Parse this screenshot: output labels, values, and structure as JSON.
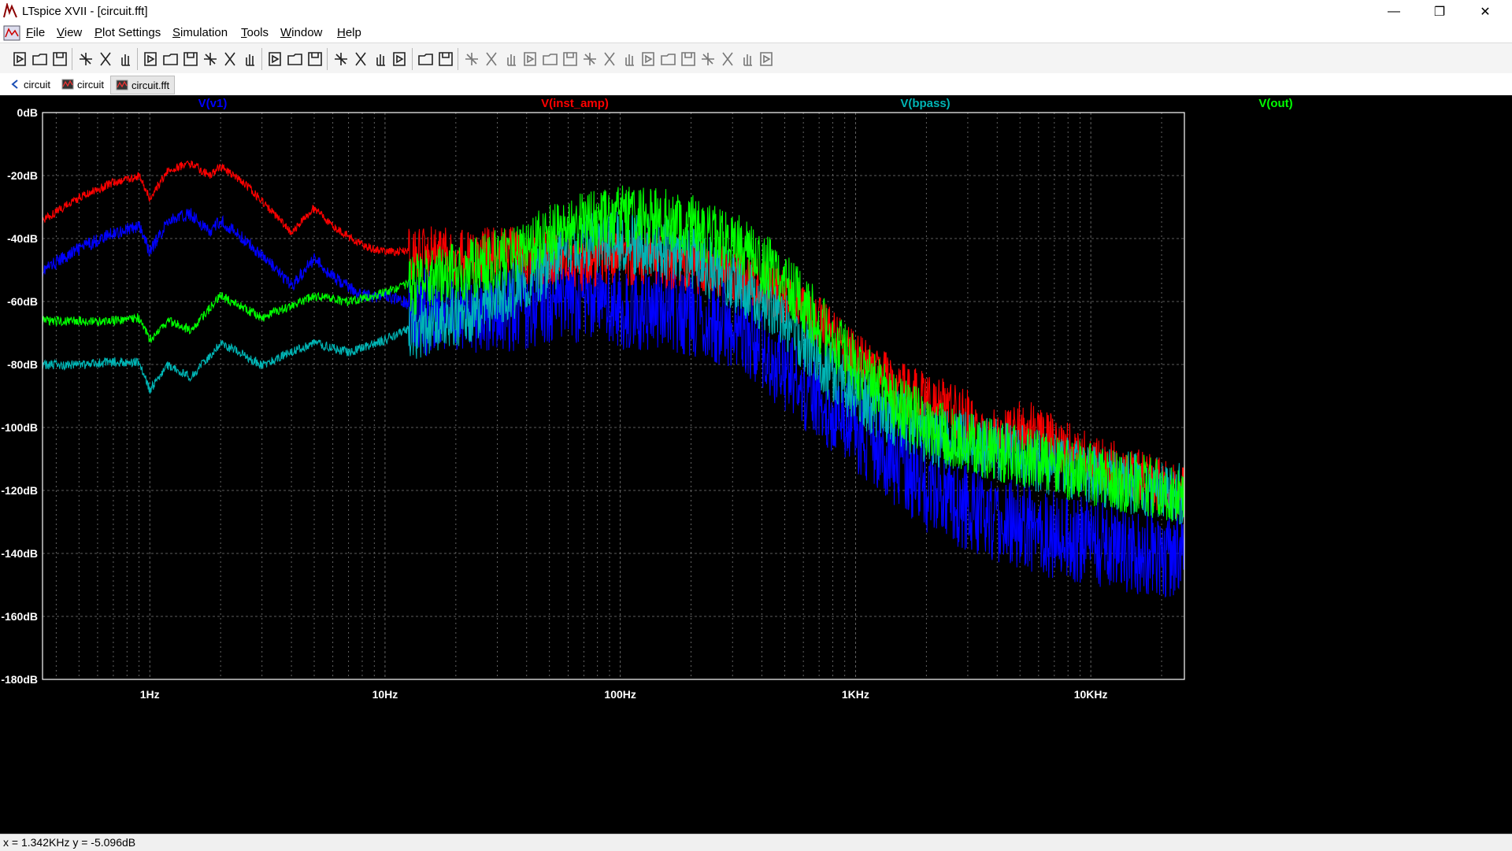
{
  "window": {
    "title": "LTspice XVII - [circuit.fft]",
    "min_glyph": "—",
    "restore_glyph": "❐",
    "close_glyph": "✕"
  },
  "menu": [
    {
      "label": "File",
      "u": "F",
      "rest": "ile"
    },
    {
      "label": "View",
      "u": "V",
      "rest": "iew"
    },
    {
      "label": "Plot Settings",
      "u": "P",
      "rest": "lot Settings"
    },
    {
      "label": "Simulation",
      "u": "S",
      "rest": "imulation"
    },
    {
      "label": "Tools",
      "u": "T",
      "rest": "ools"
    },
    {
      "label": "Window",
      "u": "W",
      "rest": "indow"
    },
    {
      "label": "Help",
      "u": "H",
      "rest": "elp"
    }
  ],
  "mdi": {
    "min": "–",
    "restore": "▫",
    "close": "×"
  },
  "tabs": [
    {
      "label": "circuit",
      "icon": "schematic-icon"
    },
    {
      "label": "circuit",
      "icon": "waveform-icon"
    },
    {
      "label": "circuit.fft",
      "icon": "waveform-icon"
    }
  ],
  "toolbar_icons": [
    "run-icon",
    "open-icon",
    "save-icon",
    "control-panel-icon",
    "halt-icon",
    "pan-icon",
    "zoom-in-icon",
    "zoom-fit-icon",
    "zoom-out-icon",
    "zoom-cancel-icon",
    "autorange-icon",
    "zoom-area-icon",
    "tile-horizontal-icon",
    "cascade-icon",
    "tile-vertical-icon",
    "cut-icon",
    "copy-icon",
    "paste-icon",
    "find-icon",
    "print-icon",
    "print-preview-icon",
    "wire-icon",
    "ground-icon",
    "label-icon",
    "resistor-icon",
    "capacitor-icon",
    "inductor-icon",
    "diode-icon",
    "component-icon",
    "move-icon",
    "drag-icon",
    "undo-icon",
    "redo-icon",
    "rotate-icon",
    "mirror-icon",
    "text-icon",
    "spice-directive-icon"
  ],
  "chart_data": {
    "type": "line",
    "x_scale": "log",
    "x_unit": "Hz",
    "xlim": [
      0.35,
      25000
    ],
    "ylim": [
      -180,
      0
    ],
    "grid": true,
    "legend_placement": "top",
    "x_ticks": [
      {
        "v": 1,
        "label": "1Hz"
      },
      {
        "v": 10,
        "label": "10Hz"
      },
      {
        "v": 100,
        "label": "100Hz"
      },
      {
        "v": 1000,
        "label": "1KHz"
      },
      {
        "v": 10000,
        "label": "10KHz"
      }
    ],
    "y_ticks": [
      {
        "v": 0,
        "label": "0dB"
      },
      {
        "v": -20,
        "label": "-20dB"
      },
      {
        "v": -40,
        "label": "-40dB"
      },
      {
        "v": -60,
        "label": "-60dB"
      },
      {
        "v": -80,
        "label": "-80dB"
      },
      {
        "v": -100,
        "label": "-100dB"
      },
      {
        "v": -120,
        "label": "-120dB"
      },
      {
        "v": -140,
        "label": "-140dB"
      },
      {
        "v": -160,
        "label": "-160dB"
      },
      {
        "v": -180,
        "label": "-180dB"
      }
    ],
    "series": [
      {
        "name": "V(v1)",
        "color": "#0000ff",
        "ripple": 14,
        "x": [
          0.35,
          0.5,
          0.7,
          0.9,
          1,
          1.2,
          1.5,
          1.8,
          2,
          2.5,
          3,
          4,
          5,
          6,
          8,
          10,
          15,
          20,
          30,
          50,
          70,
          100,
          150,
          200,
          300,
          500,
          700,
          1000,
          1500,
          2000,
          3000,
          5000,
          7000,
          10000,
          15000,
          25000
        ],
        "y": [
          -50,
          -43,
          -38,
          -36,
          -44,
          -34,
          -32,
          -38,
          -34,
          -40,
          -45,
          -55,
          -46,
          -52,
          -58,
          -58,
          -62,
          -60,
          -62,
          -58,
          -58,
          -60,
          -60,
          -62,
          -66,
          -80,
          -90,
          -100,
          -110,
          -118,
          -124,
          -130,
          -133,
          -135,
          -138,
          -140
        ]
      },
      {
        "name": "V(inst_amp)",
        "color": "#ff0000",
        "ripple": 9,
        "x": [
          0.35,
          0.5,
          0.7,
          0.9,
          1,
          1.2,
          1.5,
          1.8,
          2,
          2.5,
          3,
          4,
          5,
          6,
          8,
          10,
          15,
          20,
          30,
          50,
          70,
          100,
          150,
          200,
          300,
          500,
          700,
          1000,
          1500,
          2000,
          3000,
          3500,
          5000,
          7000,
          10000,
          15000,
          25000
        ],
        "y": [
          -34,
          -27,
          -22,
          -20,
          -27,
          -18,
          -16,
          -20,
          -17,
          -22,
          -28,
          -38,
          -30,
          -36,
          -42,
          -44,
          -44,
          -45,
          -44,
          -45,
          -47,
          -45,
          -46,
          -48,
          -50,
          -58,
          -66,
          -78,
          -86,
          -90,
          -96,
          -104,
          -98,
          -104,
          -110,
          -114,
          -120
        ]
      },
      {
        "name": "V(bpass)",
        "color": "#00b4b4",
        "ripple": 10,
        "x": [
          0.35,
          0.5,
          0.7,
          0.9,
          1,
          1.2,
          1.5,
          2,
          3,
          5,
          7,
          10,
          15,
          20,
          30,
          50,
          70,
          100,
          150,
          200,
          300,
          500,
          700,
          1000,
          1500,
          2000,
          3000,
          5000,
          10000,
          25000
        ],
        "y": [
          -80,
          -80,
          -79,
          -79,
          -88,
          -80,
          -84,
          -73,
          -80,
          -73,
          -76,
          -72,
          -66,
          -64,
          -58,
          -48,
          -40,
          -40,
          -42,
          -45,
          -52,
          -64,
          -78,
          -88,
          -97,
          -101,
          -104,
          -108,
          -114,
          -120
        ]
      },
      {
        "name": "V(out)",
        "color": "#00ff00",
        "ripple": 10,
        "x": [
          0.35,
          0.5,
          0.7,
          0.9,
          1,
          1.2,
          1.5,
          2,
          3,
          5,
          7,
          10,
          15,
          20,
          30,
          50,
          70,
          100,
          150,
          200,
          300,
          500,
          700,
          1000,
          1500,
          2000,
          3000,
          5000,
          10000,
          25000
        ],
        "y": [
          -66,
          -66,
          -66,
          -65,
          -72,
          -66,
          -69,
          -58,
          -65,
          -58,
          -60,
          -57,
          -52,
          -50,
          -46,
          -38,
          -34,
          -32,
          -33,
          -35,
          -40,
          -52,
          -66,
          -80,
          -92,
          -98,
          -104,
          -108,
          -114,
          -120
        ]
      }
    ]
  },
  "status": {
    "text": "x = 1.342KHz   y = -5.096dB"
  }
}
